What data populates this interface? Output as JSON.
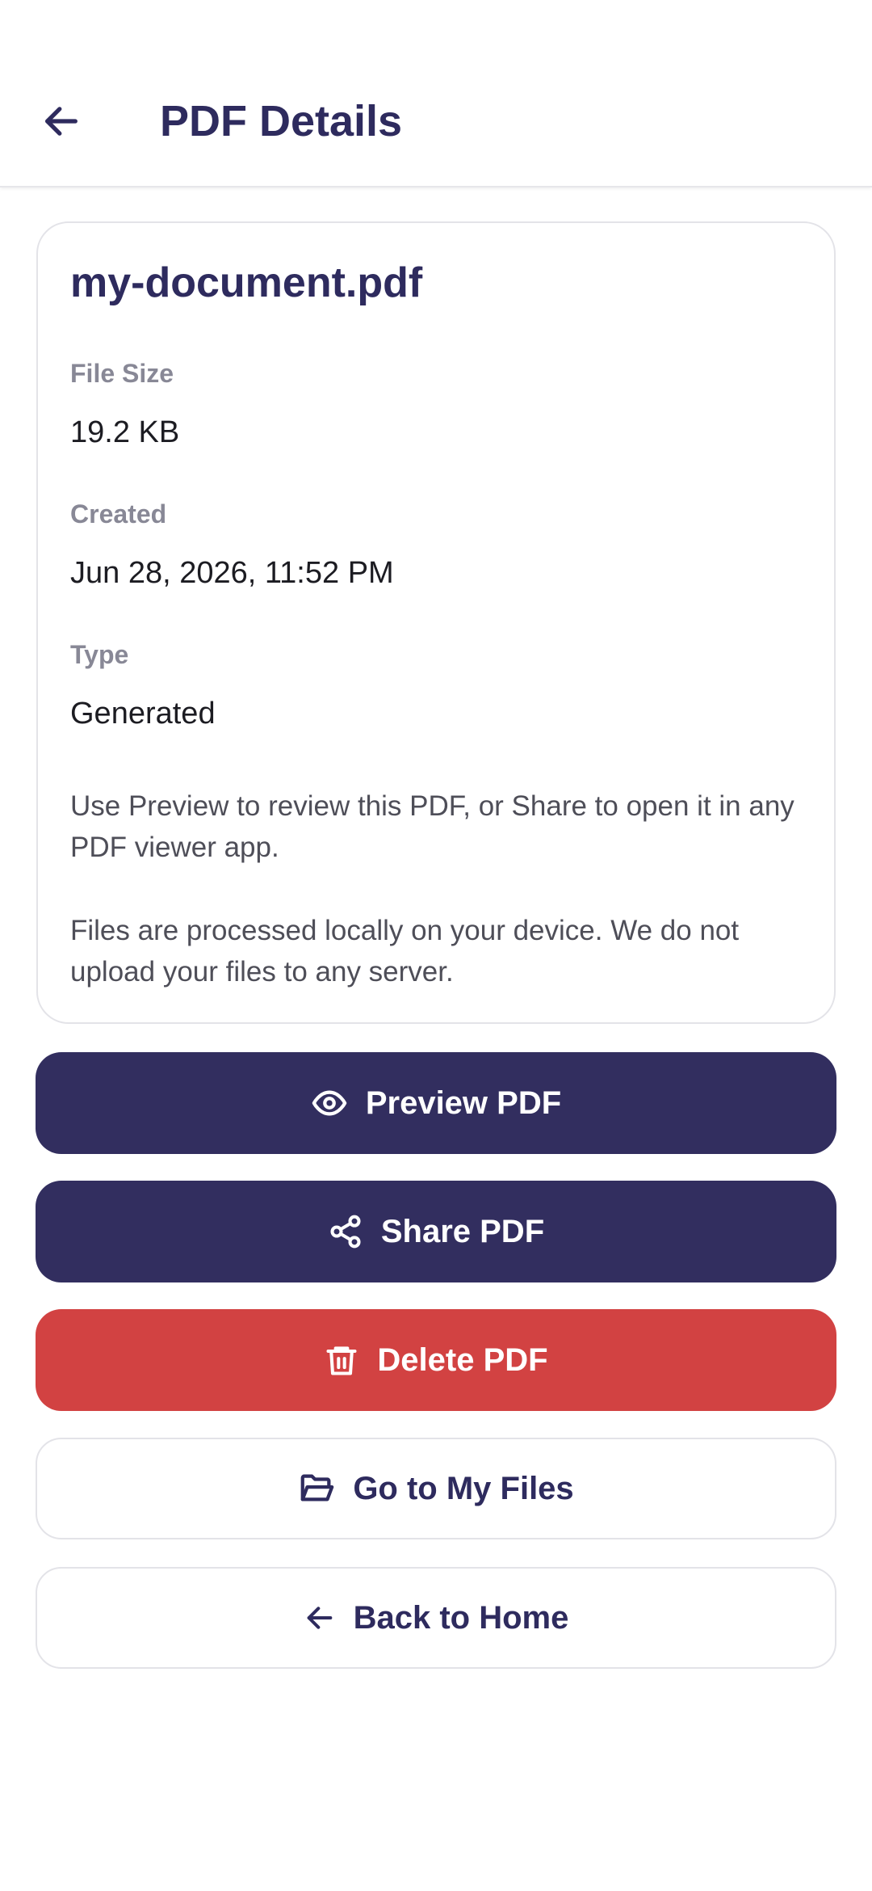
{
  "header": {
    "back_icon": "arrow-left-icon",
    "title": "PDF Details"
  },
  "file": {
    "name": "my-document.pdf",
    "fields": [
      {
        "label": "File Size",
        "value": "19.2 KB"
      },
      {
        "label": "Created",
        "value": "Jun 28, 2026, 11:52 PM"
      },
      {
        "label": "Type",
        "value": "Generated"
      }
    ],
    "notes": [
      "Use Preview to review this PDF, or Share to open it in any PDF viewer app.",
      "Files are processed locally on your device. We do not upload your files to any server."
    ]
  },
  "actions": {
    "preview": {
      "label": "Preview PDF",
      "icon": "eye-icon"
    },
    "share": {
      "label": "Share PDF",
      "icon": "share-icon"
    },
    "delete": {
      "label": "Delete PDF",
      "icon": "trash-icon"
    },
    "my_files": {
      "label": "Go to My Files",
      "icon": "folder-open-icon"
    },
    "home": {
      "label": "Back to Home",
      "icon": "arrow-left-icon"
    }
  },
  "colors": {
    "primary": "#322e5f",
    "danger": "#d24242",
    "title_text": "#2e2b5e",
    "label_text": "#888896"
  }
}
